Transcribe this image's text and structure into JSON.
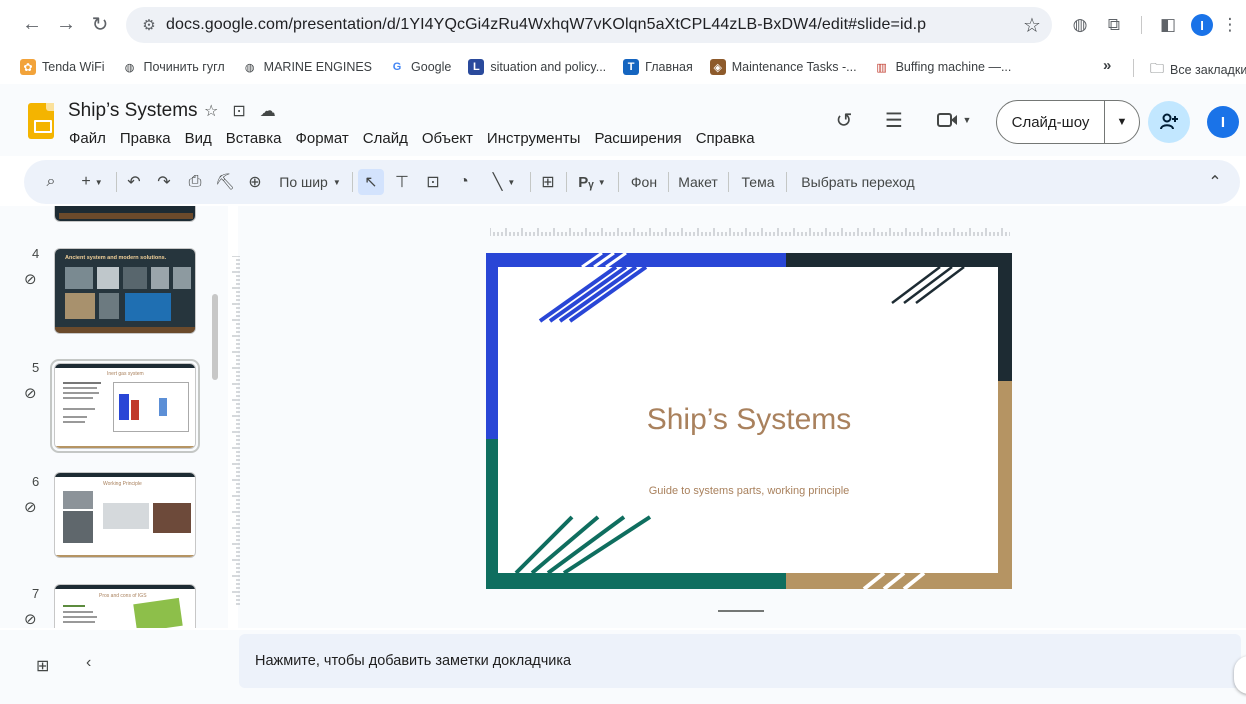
{
  "browser": {
    "url": "docs.google.com/presentation/d/1YI4YQcGi4zRu4WxhqW7vKOlqn5aXtCPL44zLB-BxDW4/edit#slide=id.p",
    "profile_initial": "I"
  },
  "bookmarks": {
    "items": [
      {
        "label": "Tenda WiFi",
        "icon": "tenda-icon",
        "glyph": "✿",
        "bg": "#f2a33a",
        "fg": "#ffffff"
      },
      {
        "label": "Починить гугл",
        "icon": "globe-icon",
        "glyph": "◍",
        "bg": "#ffffff",
        "fg": "#3c4043"
      },
      {
        "label": "MARINE ENGINES",
        "icon": "globe-icon",
        "glyph": "◍",
        "bg": "#ffffff",
        "fg": "#3c4043"
      },
      {
        "label": "Google",
        "icon": "google-icon",
        "glyph": "G",
        "bg": "#ffffff",
        "fg": "#4285f4"
      },
      {
        "label": "situation and policy...",
        "icon": "bookmark-site-icon",
        "glyph": "L",
        "bg": "#2a4a9c",
        "fg": "#ffffff"
      },
      {
        "label": "Главная",
        "icon": "telegram-t-icon",
        "glyph": "T",
        "bg": "#1565c0",
        "fg": "#ffffff"
      },
      {
        "label": "Maintenance Tasks -...",
        "icon": "maintenance-icon",
        "glyph": "◈",
        "bg": "#8d5a2b",
        "fg": "#ffffff"
      },
      {
        "label": "Buffing machine —...",
        "icon": "books-icon",
        "glyph": "▥",
        "bg": "#ffffff",
        "fg": "#c0392b"
      }
    ],
    "overflow": "»",
    "all_bookmarks": "Все закладки"
  },
  "app": {
    "title": "Ship’s Systems",
    "menu": [
      "Файл",
      "Правка",
      "Вид",
      "Вставка",
      "Формат",
      "Слайд",
      "Объект",
      "Инструменты",
      "Расширения",
      "Справка"
    ],
    "slideshow_label": "Слайд-шоу",
    "user_initial": "I"
  },
  "toolbar": {
    "zoom": "По шир",
    "items": [
      "Фон",
      "Макет",
      "Тема",
      "Выбрать переход"
    ]
  },
  "filmstrip": {
    "thumbnails": [
      {
        "number": "4",
        "title": "Ancient system and modern solutions."
      },
      {
        "number": "5",
        "title": "Inert gas system"
      },
      {
        "number": "6",
        "title": "Working Principle"
      },
      {
        "number": "7",
        "title": "Pros and cons of IGS"
      }
    ]
  },
  "slide": {
    "title": "Ship’s Systems",
    "subtitle": "Guide to systems parts, working principle",
    "colors": {
      "blue": "#2946d6",
      "green": "#0f6e5f",
      "gold": "#b59463",
      "navy": "#1d2b33",
      "text": "#a9815d"
    }
  },
  "notes": {
    "placeholder": "Нажмите, чтобы добавить заметки докладчика"
  }
}
